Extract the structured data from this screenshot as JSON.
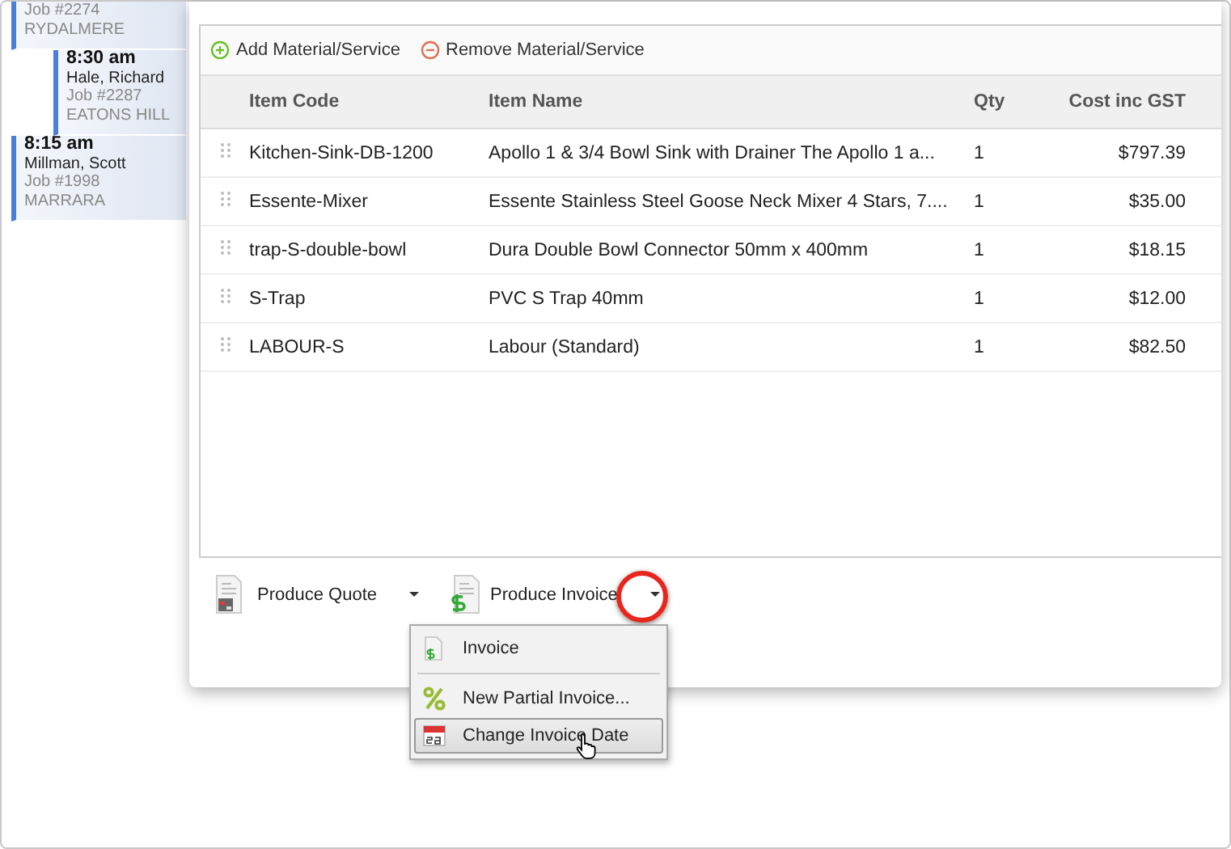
{
  "schedule": [
    {
      "job": "Job #2274",
      "suburb": "RYDALMERE",
      "indented": false
    },
    {
      "time": "8:30 am",
      "name": "Hale, Richard",
      "job": "Job #2287",
      "suburb": "EATONS HILL",
      "indented": true
    },
    {
      "time": "8:15 am",
      "name": "Millman, Scott",
      "job": "Job #1998",
      "suburb": "MARRARA",
      "indented": false
    }
  ],
  "toolbar": [
    {
      "kind": "add",
      "label": "Add Material/Service"
    },
    {
      "kind": "remove",
      "label": "Remove Material/Service"
    }
  ],
  "table": {
    "columns": [
      "Item Code",
      "Item Name",
      "Qty",
      "Cost inc GST"
    ],
    "rows": [
      [
        "Kitchen-Sink-DB-1200",
        "Apollo 1 & 3/4 Bowl Sink with Drainer The Apollo 1 a...",
        "1",
        "$797.39"
      ],
      [
        "Essente-Mixer",
        "Essente Stainless Steel Goose Neck Mixer 4 Stars, 7....",
        "1",
        "$35.00"
      ],
      [
        "trap-S-double-bowl",
        "Dura Double Bowl Connector 50mm x 400mm",
        "1",
        "$18.15"
      ],
      [
        "S-Trap",
        "PVC S Trap 40mm",
        "1",
        "$12.00"
      ],
      [
        "LABOUR-S",
        "Labour (Standard)",
        "1",
        "$82.50"
      ]
    ]
  },
  "actions": [
    {
      "kind": "quote",
      "label": "Produce Quote"
    },
    {
      "kind": "invoice",
      "label": "Produce Invoice"
    }
  ],
  "menu": [
    {
      "kind": "invoice",
      "label": "Invoice",
      "selected": false
    },
    {
      "kind": "partial",
      "label": "New Partial Invoice...",
      "selected": false
    },
    {
      "kind": "date",
      "label": "Change Invoice Date",
      "selected": true
    }
  ]
}
